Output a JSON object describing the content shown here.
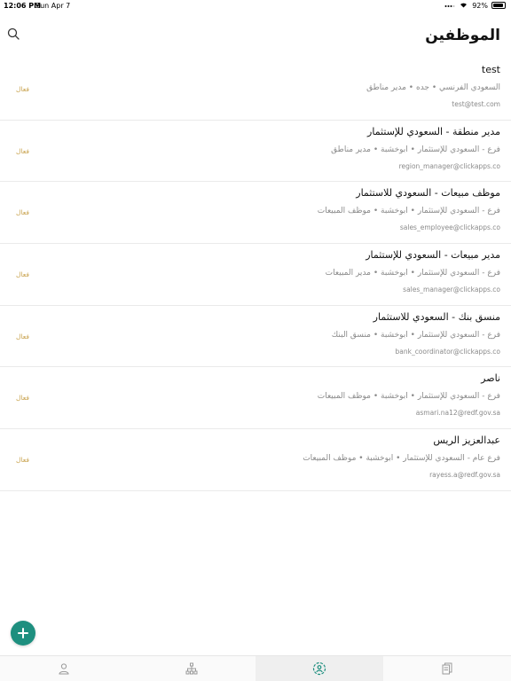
{
  "status_bar": {
    "time": "12:06 PM",
    "date": "Sun Apr 7",
    "battery": "92%",
    "battery_level": 0.92
  },
  "header": {
    "title": "الموظفين",
    "search_icon": "search-icon"
  },
  "employees": [
    {
      "name": "test",
      "meta": "السعودي الفرنسي • جده • مدير مناطق",
      "email": "test@test.com",
      "status": "فعال"
    },
    {
      "name": "مدير منطقة - السعودي للإستثمار",
      "meta": "فرع - السعودي للإستثمار • ابوخشبة • مدير مناطق",
      "email": "region_manager@clickapps.co",
      "status": "فعال"
    },
    {
      "name": "موظف مبيعات - السعودي للاستثمار",
      "meta": "فرع - السعودي للإستثمار • ابوخشبة • موظف المبيعات",
      "email": "sales_employee@clickapps.co",
      "status": "فعال"
    },
    {
      "name": "مدير مبيعات - السعودي للإستثمار",
      "meta": "فرع - السعودي للإستثمار • ابوخشبة • مدير المبيعات",
      "email": "sales_manager@clickapps.co",
      "status": "فعال"
    },
    {
      "name": "منسق بنك - السعودي للاستثمار",
      "meta": "فرع - السعودي للإستثمار • ابوخشبة • منسق البنك",
      "email": "bank_coordinator@clickapps.co",
      "status": "فعال"
    },
    {
      "name": "ناصر",
      "meta": "فرع - السعودي للإستثمار • ابوخشبة • موظف المبيعات",
      "email": "asmari.na12@redf.gov.sa",
      "status": "فعال"
    },
    {
      "name": "عبدالعزيز الريس",
      "meta": "فرع عام - السعودي للإستثمار • ابوخشبة • موظف المبيعات",
      "email": "rayess.a@redf.gov.sa",
      "status": "فعال"
    }
  ],
  "fab": {
    "icon": "plus-icon"
  },
  "tabs": [
    {
      "icon": "user-icon",
      "active": false
    },
    {
      "icon": "org-chart-icon",
      "active": false
    },
    {
      "icon": "team-icon",
      "active": true
    },
    {
      "icon": "documents-icon",
      "active": false
    }
  ],
  "colors": {
    "accent": "#1e8f7f",
    "status": "#c9a34f",
    "muted_text": "#8a8a8a"
  }
}
